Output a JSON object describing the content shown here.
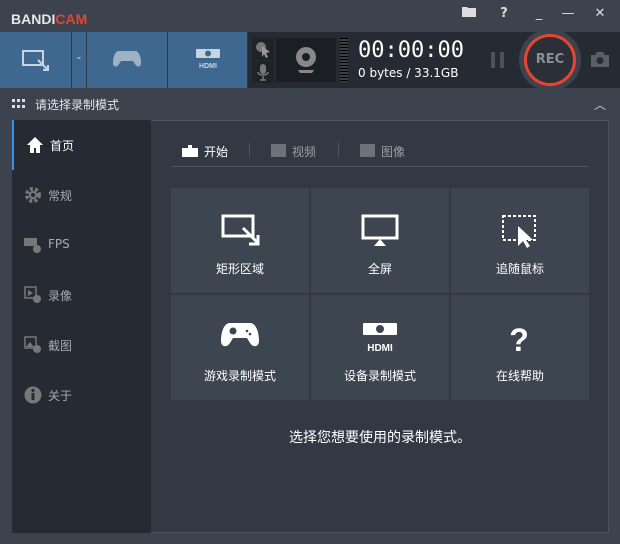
{
  "app": {
    "logo_prefix": "BANDI",
    "logo_suffix": "CAM"
  },
  "titlebar": {
    "folder_icon": "folder-icon",
    "help": "?",
    "minimize_small": "_",
    "minimize": "—",
    "close": "✕"
  },
  "toolbar": {
    "timer": "00:00:00",
    "size": "0 bytes / 33.1GB",
    "rec_label": "REC"
  },
  "mode_header": {
    "title": "请选择录制模式"
  },
  "sidebar": {
    "items": [
      {
        "label": "首页",
        "icon": "home-icon"
      },
      {
        "label": "常规",
        "icon": "gear-icon"
      },
      {
        "label": "FPS",
        "icon": "fps-icon"
      },
      {
        "label": "录像",
        "icon": "video-settings-icon"
      },
      {
        "label": "截图",
        "icon": "image-settings-icon"
      },
      {
        "label": "关于",
        "icon": "info-icon"
      }
    ]
  },
  "tabs": [
    {
      "label": "开始"
    },
    {
      "label": "视频"
    },
    {
      "label": "图像"
    }
  ],
  "grid": [
    {
      "label": "矩形区域"
    },
    {
      "label": "全屏"
    },
    {
      "label": "追随鼠标"
    },
    {
      "label": "游戏录制模式"
    },
    {
      "label": "设备录制模式"
    },
    {
      "label": "在线帮助"
    }
  ],
  "footer": {
    "text": "选择您想要使用的录制模式。"
  },
  "colors": {
    "accent": "#3f6890",
    "rec": "#e8442f",
    "active": "#3b8fe6"
  }
}
